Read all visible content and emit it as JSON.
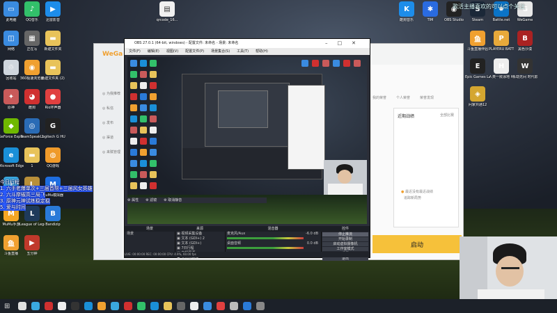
{
  "desktop_left_icons": [
    {
      "label": "此电脑",
      "color": "#3a8be0",
      "glyph": "▭"
    },
    {
      "label": "QQ音乐",
      "color": "#32c06a",
      "glyph": "♪"
    },
    {
      "label": "迅雷影音",
      "color": "#1d8dea",
      "glyph": "▶"
    },
    {
      "label": "网络",
      "color": "#3a8be0",
      "glyph": "◫"
    },
    {
      "label": "正在写",
      "color": "#666",
      "glyph": "▦"
    },
    {
      "label": "新建文件夹",
      "color": "#e8c35a",
      "glyph": "▬"
    },
    {
      "label": "回收站",
      "color": "#cfd6de",
      "glyph": "♲"
    },
    {
      "label": "360极速浏览器",
      "color": "#f0a030",
      "glyph": "◉"
    },
    {
      "label": "新建文件夹 (2)",
      "color": "#e8c35a",
      "glyph": "▬"
    },
    {
      "label": "原神",
      "color": "#c95a5a",
      "glyph": "✦"
    },
    {
      "label": "酷狗",
      "color": "#d03030",
      "glyph": "◕"
    },
    {
      "label": "Rio环声器",
      "color": "#e04040",
      "glyph": "●"
    },
    {
      "label": "GeForce Experience",
      "color": "#6fb800",
      "glyph": "◆"
    },
    {
      "label": "TeamSpeak 3",
      "color": "#2a6bb5",
      "glyph": "◎"
    },
    {
      "label": "Logitech G HUB",
      "color": "#222",
      "glyph": "G"
    },
    {
      "label": "Microsoft Edge",
      "color": "#1a8fd8",
      "glyph": "e"
    },
    {
      "label": "1",
      "color": "#e8c35a",
      "glyph": "▬"
    },
    {
      "label": "QQ游戏",
      "color": "#ef9a2a",
      "glyph": "◍"
    },
    {
      "label": "QQ",
      "color": "#3aa8e0",
      "glyph": "✈"
    },
    {
      "label": "League of",
      "color": "#b88f3a",
      "glyph": "L"
    },
    {
      "label": "MuMu模拟器",
      "color": "#1e6de0",
      "glyph": "M"
    },
    {
      "label": "MuMu手游",
      "color": "#f5a623",
      "glyph": "M"
    },
    {
      "label": "League of Legends",
      "color": "#1e3a5a",
      "glyph": "L"
    },
    {
      "label": "Bandizip",
      "color": "#2a7ad8",
      "glyph": "B"
    },
    {
      "label": "斗鱼直播",
      "color": "#f0a030",
      "glyph": "鱼"
    },
    {
      "label": "五分钟",
      "color": "#c0392b",
      "glyph": "▶"
    }
  ],
  "desktop_right_icons": [
    {
      "label": "酷狗音乐",
      "color": "#1d8dea",
      "glyph": "K"
    },
    {
      "label": "TIM",
      "color": "#2a6be0",
      "glyph": "✱"
    },
    {
      "label": "OBS Studio",
      "color": "#222",
      "glyph": "◉"
    },
    {
      "label": "Steam",
      "color": "#1b2838",
      "glyph": "S"
    },
    {
      "label": "Battle.net",
      "color": "#0a74c8",
      "glyph": "✹"
    },
    {
      "label": "WeGame",
      "color": "#e8e8e8",
      "glyph": "G"
    },
    {
      "label": "斗鱼直播伴侣",
      "color": "#f0a030",
      "glyph": "鱼"
    },
    {
      "label": "PLAYERU BATTLEGR...",
      "color": "#e8a93a",
      "glyph": "P"
    },
    {
      "label": "黑色沙漠",
      "color": "#aa2222",
      "glyph": "B"
    },
    {
      "label": "Epic Games Launcher",
      "color": "#222",
      "glyph": "E"
    },
    {
      "label": "人类一败涂地 Human Fa...",
      "color": "#eee",
      "glyph": "H"
    },
    {
      "label": "永劫无间 时代影享",
      "color": "#333",
      "glyph": "W"
    },
    {
      "label": "问家共通12",
      "color": "#d4a630",
      "glyph": "◈"
    }
  ],
  "topright_text": "歌活主播喜欢的可以点个关注",
  "obs": {
    "title": "OBS 27.0.1 (64-bit, windows) - 配置文件: 未命名 - 场景: 未命名",
    "menu": [
      "文件(F)",
      "编辑(E)",
      "视图(V)",
      "配置文件(P)",
      "场景集合(S)",
      "工具(T)",
      "帮助(H)"
    ],
    "docks": {
      "scenes": {
        "header": "场景",
        "items": [
          "场景"
        ]
      },
      "sources": {
        "header": "来源",
        "items": [
          "视频采集设备",
          "文本 (GDI+) 2",
          "文本 (GDI+)",
          "7日行程",
          "本机图源",
          "显示器捕获"
        ]
      },
      "mixer": {
        "header": "混音器",
        "channels": [
          {
            "name": "麦克风/Aux",
            "db": "-6.0 dB"
          },
          {
            "name": "桌面音频",
            "db": "0.0 dB"
          }
        ]
      },
      "controls": {
        "header": "控件",
        "buttons": [
          "停止推流",
          "开始录制",
          "启动虚拟摄像机",
          "工作室模式",
          "设置",
          "退出"
        ]
      }
    },
    "preview_bar": [
      "属性",
      "滤镜",
      "取消静音"
    ],
    "status": "LIVE: 00:00:00  REC: 00:00:00  CPU: 4.9%, 60.00 fps"
  },
  "overlay_lines": [
    "今日行程",
    "1. 六手老爆单次+三届首帮+三届风女英雄",
    "2. 六斗摩椒高三局飞",
    "3. 原神元神试练稳定稳",
    "5. 爱与时间"
  ],
  "wegame": {
    "logo": "WeGa",
    "side_items": [
      "为我推荐",
      "私信",
      "发布",
      "渠道",
      "来赋管理"
    ],
    "tabs": [
      "我的荣誉",
      "个人荣誉",
      "荣誉发现"
    ],
    "card_title": "近期战绩",
    "card_filter": "全部比赛",
    "card_msg": [
      "最近没有最近战绩",
      "追踪新局势"
    ],
    "launch": "启动"
  },
  "taskbar": {
    "colors": [
      "#e0e0e0",
      "#3aa8e0",
      "#d03030",
      "#eee",
      "#333",
      "#1a8fd8",
      "#f0a030",
      "#3aa8e0",
      "#d03030",
      "#32c06a",
      "#1a8fd8",
      "#e8c35a",
      "#666",
      "#eee",
      "#3a8be0",
      "#e04040",
      "#bbb",
      "#2a7ad8",
      "#888"
    ]
  }
}
